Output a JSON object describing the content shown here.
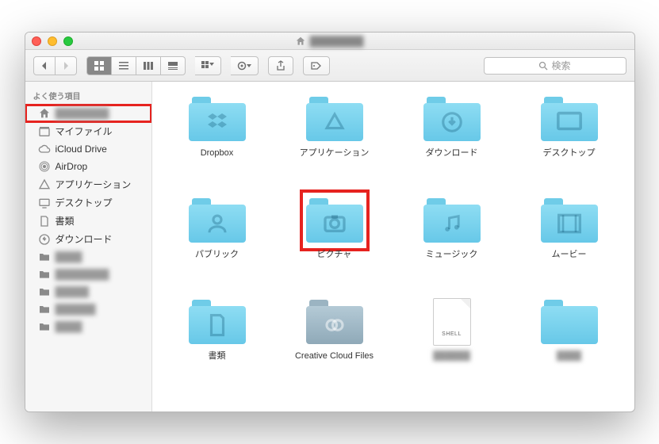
{
  "window": {
    "title_blurred": "████████"
  },
  "toolbar": {
    "search_placeholder": "検索"
  },
  "sidebar": {
    "header": "よく使う項目",
    "items": [
      {
        "label": "████████",
        "icon": "home",
        "blur": true,
        "highlighted": true
      },
      {
        "label": "マイファイル",
        "icon": "myfiles"
      },
      {
        "label": "iCloud Drive",
        "icon": "cloud"
      },
      {
        "label": "AirDrop",
        "icon": "airdrop"
      },
      {
        "label": "アプリケーション",
        "icon": "apps"
      },
      {
        "label": "デスクトップ",
        "icon": "desktop"
      },
      {
        "label": "書類",
        "icon": "doc"
      },
      {
        "label": "ダウンロード",
        "icon": "download"
      },
      {
        "label": "████",
        "icon": "folder",
        "blur": true
      },
      {
        "label": "████████",
        "icon": "folder",
        "blur": true
      },
      {
        "label": "█████",
        "icon": "folder",
        "blur": true
      },
      {
        "label": "██████",
        "icon": "folder",
        "blur": true
      },
      {
        "label": "████",
        "icon": "folder",
        "blur": true
      }
    ]
  },
  "grid": {
    "items": [
      {
        "name": "Dropbox",
        "type": "folder-cyan",
        "glyph": "dropbox"
      },
      {
        "name": "アプリケーション",
        "type": "folder-cyan",
        "glyph": "apps"
      },
      {
        "name": "ダウンロード",
        "type": "folder-cyan",
        "glyph": "download"
      },
      {
        "name": "デスクトップ",
        "type": "folder-cyan",
        "glyph": "desktop"
      },
      {
        "name": "パブリック",
        "type": "folder-cyan",
        "glyph": "public"
      },
      {
        "name": "ピクチャ",
        "type": "folder-cyan",
        "glyph": "pictures",
        "highlighted": true
      },
      {
        "name": "ミュージック",
        "type": "folder-cyan",
        "glyph": "music"
      },
      {
        "name": "ムービー",
        "type": "folder-cyan",
        "glyph": "movies"
      },
      {
        "name": "書類",
        "type": "folder-cyan",
        "glyph": "doc"
      },
      {
        "name": "Creative Cloud Files",
        "type": "folder-gray",
        "glyph": "cc"
      },
      {
        "name": "██████",
        "type": "file-shell",
        "blur": true,
        "tag": "SHELL"
      },
      {
        "name": "████",
        "type": "folder-cyan",
        "blur": true
      }
    ]
  }
}
